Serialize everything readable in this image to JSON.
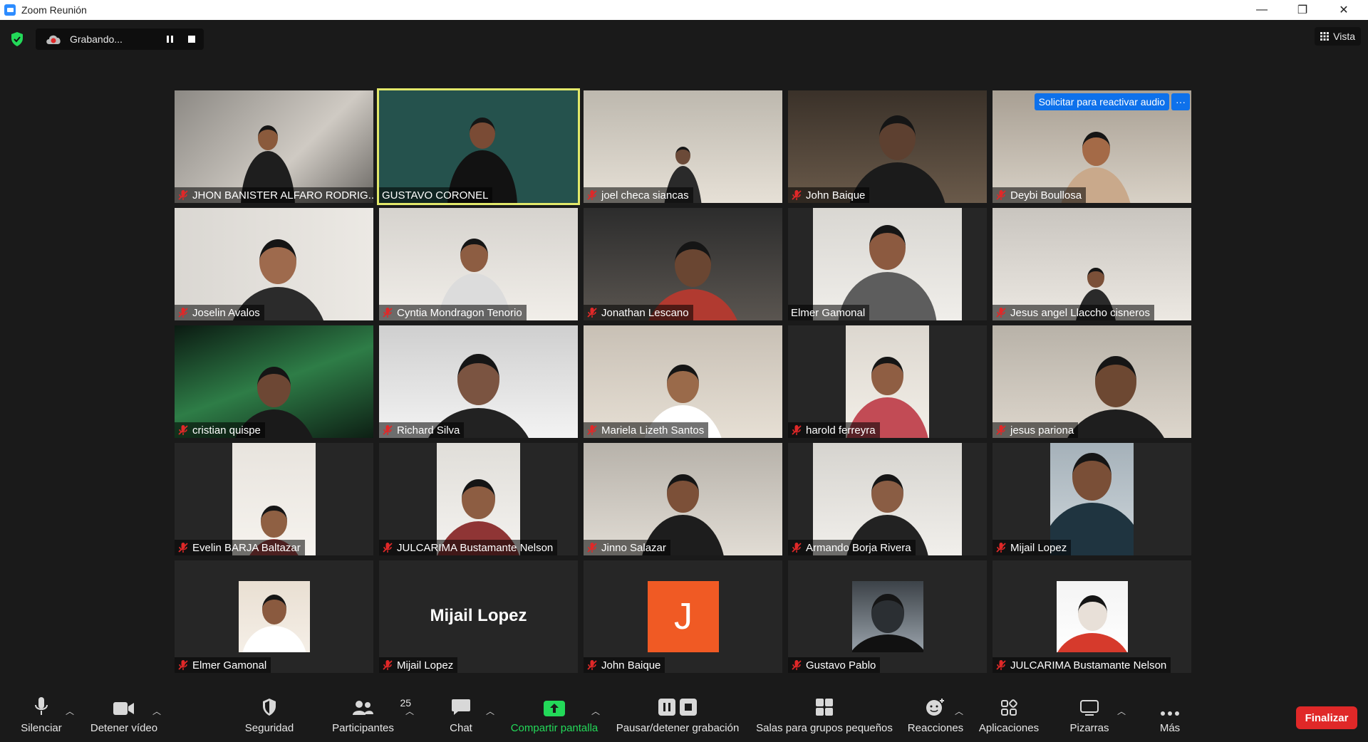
{
  "window": {
    "title": "Zoom Reunión",
    "minimize": "—",
    "restore": "❐",
    "close": "✕"
  },
  "recording": {
    "status": "Grabando..."
  },
  "view": {
    "label": "Vista"
  },
  "unmute_request": {
    "label": "Solicitar para reactivar audio",
    "more": "···"
  },
  "tiles": [
    {
      "name": "JHON BANISTER ALFARO RODRIG...",
      "muted": true
    },
    {
      "name": "GUSTAVO CORONEL",
      "muted": false,
      "active": true
    },
    {
      "name": "joel checa siancas",
      "muted": true
    },
    {
      "name": "John Baique",
      "muted": true
    },
    {
      "name": "Deybi Boullosa",
      "muted": true
    },
    {
      "name": "Joselin Avalos",
      "muted": true
    },
    {
      "name": "Cyntia Mondragon Tenorio",
      "muted": true
    },
    {
      "name": "Jonathan Lescano",
      "muted": true
    },
    {
      "name": "Elmer Gamonal",
      "muted": false
    },
    {
      "name": "Jesus angel Llaccho cisneros",
      "muted": true
    },
    {
      "name": "cristian quispe",
      "muted": true
    },
    {
      "name": "Richard Silva",
      "muted": true
    },
    {
      "name": "Mariela Lizeth Santos",
      "muted": true
    },
    {
      "name": "harold ferreyra",
      "muted": true
    },
    {
      "name": "jesus pariona",
      "muted": true
    },
    {
      "name": "Evelin BARJA  Baltazar",
      "muted": true
    },
    {
      "name": "JULCARIMA Bustamante Nelson",
      "muted": true
    },
    {
      "name": "Jinno Salazar",
      "muted": true
    },
    {
      "name": "Armando Borja Rivera",
      "muted": true
    },
    {
      "name": "Mijail Lopez",
      "muted": true
    },
    {
      "name": "Elmer Gamonal",
      "muted": true
    },
    {
      "name": "Mijail Lopez",
      "muted": true,
      "center_name": "Mijail Lopez"
    },
    {
      "name": "John Baique",
      "muted": true,
      "initial": "J"
    },
    {
      "name": "Gustavo Pablo",
      "muted": true
    },
    {
      "name": "JULCARIMA Bustamante Nelson",
      "muted": true
    }
  ],
  "toolbar": {
    "mute": "Silenciar",
    "video": "Detener vídeo",
    "security": "Seguridad",
    "participants": "Participantes",
    "participants_count": "25",
    "chat": "Chat",
    "share": "Compartir pantalla",
    "recording": "Pausar/detener grabación",
    "breakout": "Salas para grupos pequeños",
    "reactions": "Reacciones",
    "apps": "Aplicaciones",
    "whiteboards": "Pizarras",
    "more": "Más",
    "end": "Finalizar"
  },
  "colors": {
    "accent": "#0e71eb",
    "end": "#e02828",
    "share": "#23d959",
    "active_border": "#e2e86a",
    "mute": "#e02828"
  }
}
